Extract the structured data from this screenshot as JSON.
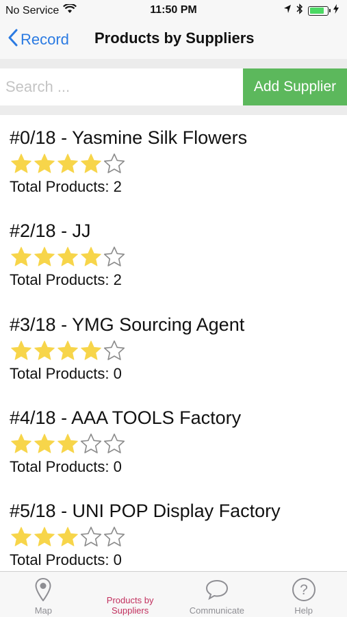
{
  "status_bar": {
    "carrier": "No Service",
    "time": "11:50 PM"
  },
  "nav": {
    "back_label": "Record",
    "title": "Products by Suppliers"
  },
  "search": {
    "placeholder": "Search ...",
    "value": ""
  },
  "add_supplier_label": "Add Supplier",
  "suppliers": [
    {
      "title": "#0/18 - Yasmine Silk Flowers",
      "rating": 4,
      "total": "Total Products: 2"
    },
    {
      "title": "#2/18 - JJ",
      "rating": 4,
      "total": "Total Products: 2"
    },
    {
      "title": "#3/18 - YMG Sourcing Agent",
      "rating": 4,
      "total": "Total Products: 0"
    },
    {
      "title": "#4/18 - AAA TOOLS Factory",
      "rating": 3,
      "total": "Total Products: 0"
    },
    {
      "title": "#5/18 - UNI POP Display Factory",
      "rating": 3,
      "total": "Total Products: 0"
    }
  ],
  "rating_max": 5,
  "tabs": [
    {
      "label": "Map",
      "icon": "map-pin-icon",
      "active": false
    },
    {
      "label": "Products by Suppliers",
      "icon": "",
      "active": true
    },
    {
      "label": "Communicate",
      "icon": "speech-bubble-icon",
      "active": false
    },
    {
      "label": "Help",
      "icon": "help-icon",
      "active": false
    }
  ],
  "colors": {
    "accent": "#2a7ae2",
    "add_button": "#5cb85c",
    "star_fill": "#f7d54a",
    "active_tab": "#c2305e"
  }
}
